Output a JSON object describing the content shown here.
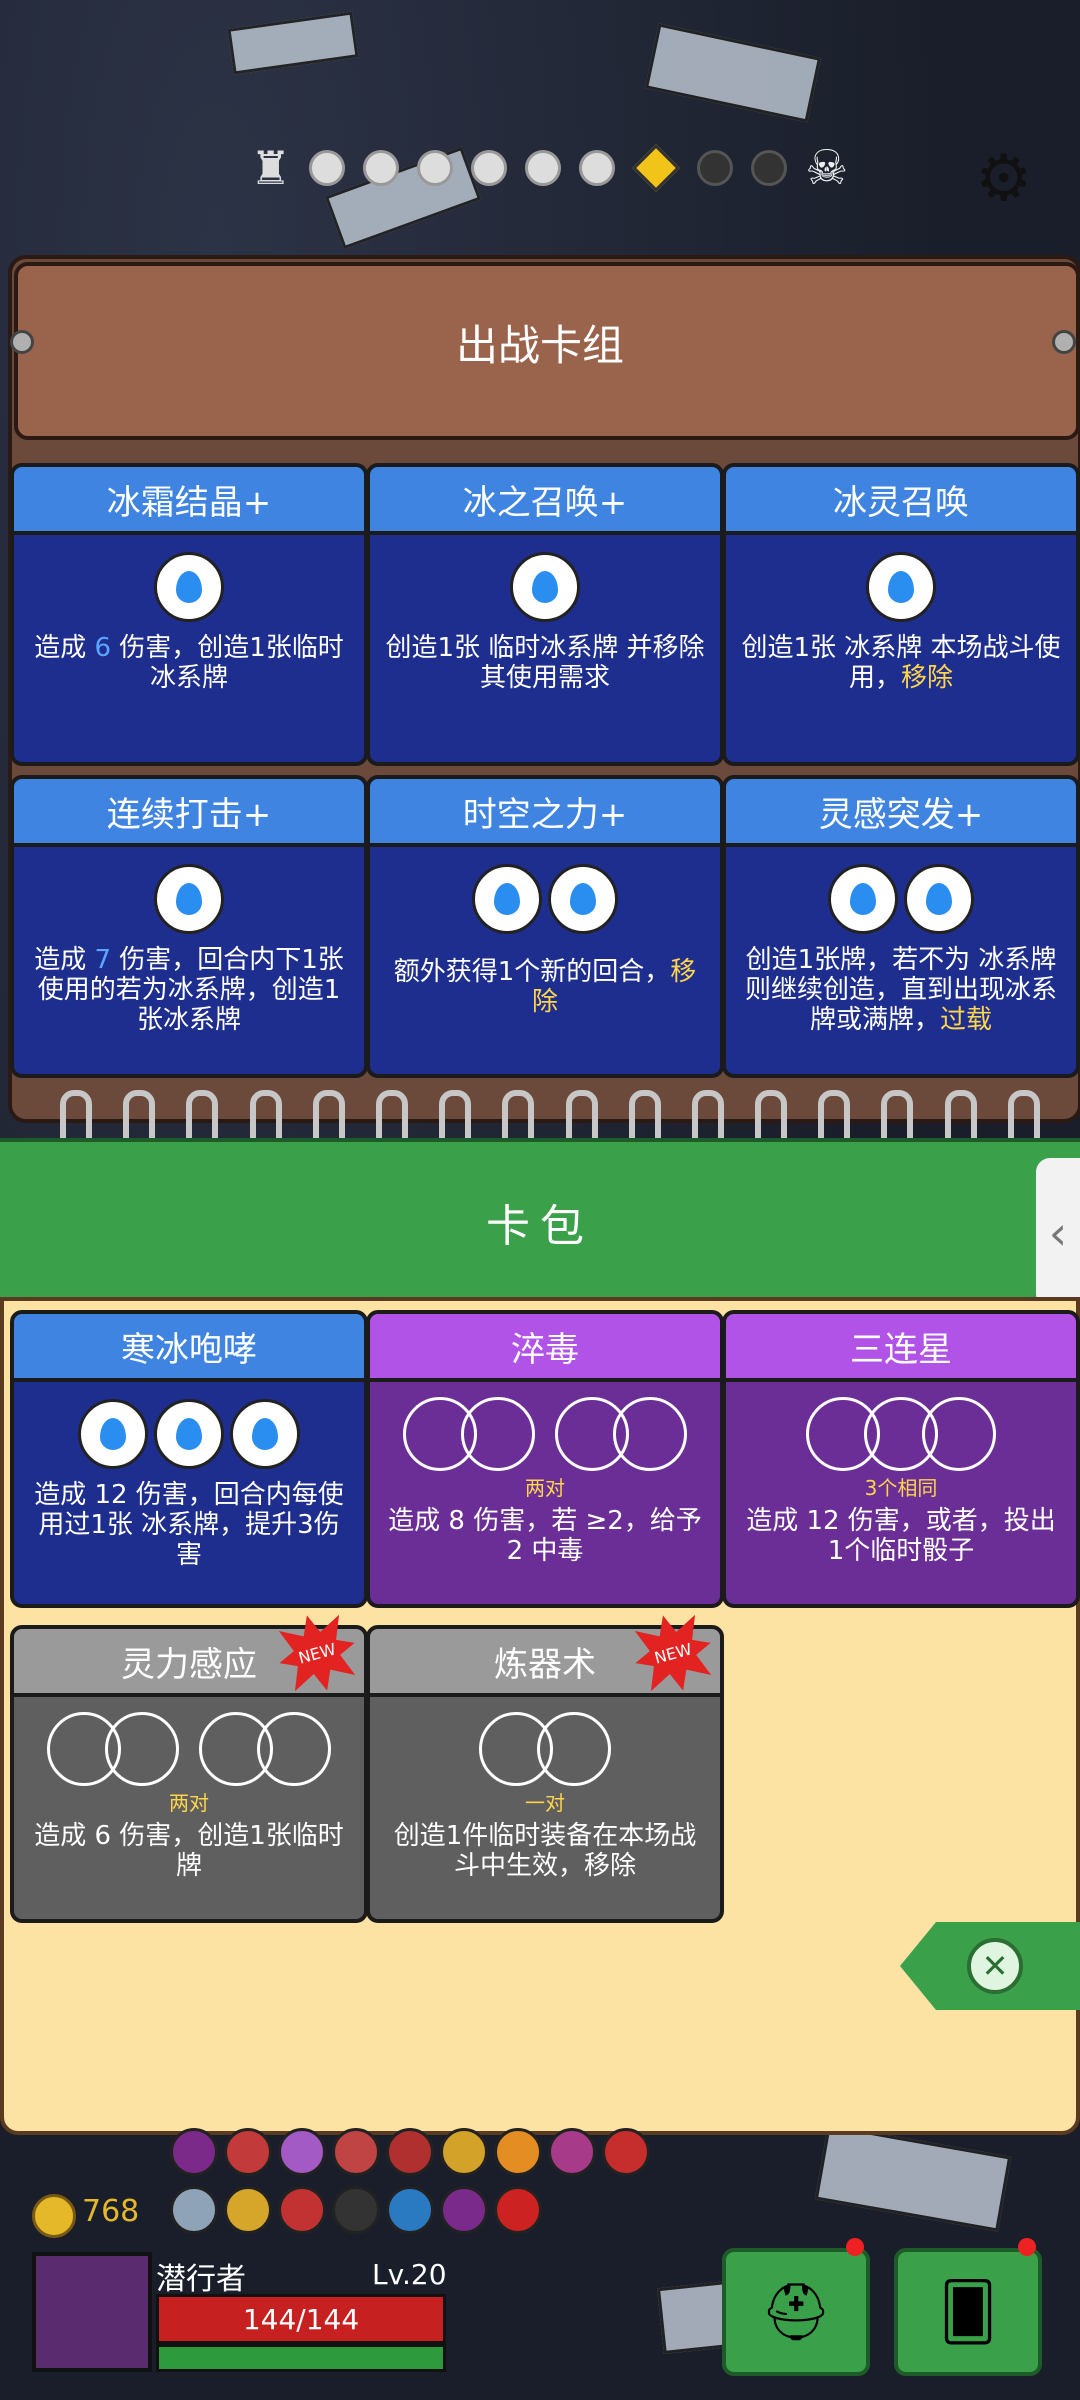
{
  "header": {
    "deck_title": "出战卡组"
  },
  "deck_cards": [
    {
      "name": "冰霜结晶+",
      "drops": 1,
      "desc_parts": [
        "造成 ",
        "6",
        " 伤害，创造1张临时",
        "冰系牌"
      ]
    },
    {
      "name": "冰之召唤+",
      "drops": 1,
      "desc_parts": [
        "创造1张 临时",
        "冰系牌 并移除其使用需求"
      ]
    },
    {
      "name": "冰灵召唤",
      "drops": 1,
      "desc_parts": [
        "创造1张 ",
        "冰系牌 本场战斗使用，",
        "移除"
      ]
    },
    {
      "name": "连续打击+",
      "drops": 1,
      "desc_parts": [
        "造成 ",
        "7",
        " 伤害，回合内下1张使用的若为",
        "冰系牌，创造1张冰系牌"
      ]
    },
    {
      "name": "时空之力+",
      "drops": 2,
      "desc_parts": [
        "额外获得1个新的回合，",
        "移除"
      ]
    },
    {
      "name": "灵感突发+",
      "drops": 2,
      "desc_parts": [
        "创造1张牌，若不为 ",
        "冰系牌则继续创造，直到出现冰系牌或满牌，",
        "过载"
      ]
    }
  ],
  "pack": {
    "title": "卡包"
  },
  "pack_cards": [
    {
      "name": "寒冰咆哮",
      "need": "",
      "desc": "造成 12 伤害，回合内每使用过1张 冰系牌，提升3伤害"
    },
    {
      "name": "淬毒",
      "need": "两对",
      "desc": "造成 8 伤害，若 ≥2，给予 2 中毒"
    },
    {
      "name": "三连星",
      "need": "3个相同",
      "desc": "造成 12 伤害，或者，投出1个临时骰子"
    },
    {
      "name": "灵力感应",
      "need": "两对",
      "desc": "造成 6 伤害，创造1张临时牌",
      "new": "NEW"
    },
    {
      "name": "炼器术",
      "need": "一对",
      "desc": "创造1件临时装备在本场战斗中生效，移除",
      "new": "NEW"
    }
  ],
  "player": {
    "coins": "768",
    "name": "潜行者",
    "level": "Lv.20",
    "hp": "144/144"
  },
  "icons": {
    "close": "close-circle-icon",
    "gear": "gear-icon",
    "castle": "castle-icon",
    "boss": "boss-skull-icon",
    "side_tab": "chevron-left-icon"
  }
}
